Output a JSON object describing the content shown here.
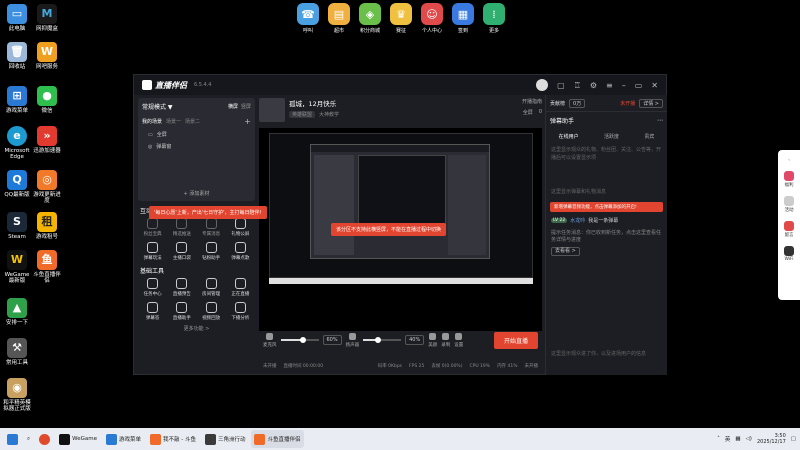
{
  "desktop": {
    "icons": [
      {
        "label": "此电脑",
        "icon": "computer-icon",
        "color": "#3d8fe0"
      },
      {
        "label": "网抑魔盒",
        "icon": "m-app-icon",
        "color": "#1a1a1a"
      },
      {
        "label": "回收站",
        "icon": "recycle-bin-icon",
        "color": "#9bb8d8"
      },
      {
        "label": "网吧服务",
        "icon": "w-service-icon",
        "color": "#f0a020"
      },
      {
        "label": "游戏菜单",
        "icon": "game-menu-icon",
        "color": "#2a7ad4"
      },
      {
        "label": "微信",
        "icon": "wechat-icon",
        "color": "#2fbf4f"
      },
      {
        "label": "Microsoft Edge",
        "icon": "edge-icon",
        "color": "#1d9bd1"
      },
      {
        "label": "迅游加速器",
        "icon": "accelerator-icon",
        "color": "#e33a2f"
      },
      {
        "label": "QQ最新版",
        "icon": "qq-icon",
        "color": "#1e7ad8"
      },
      {
        "label": "游戏更新进度",
        "icon": "update-progress-icon",
        "color": "#f07a2a"
      },
      {
        "label": "Steam",
        "icon": "steam-icon",
        "color": "#1b2838"
      },
      {
        "label": "游戏租号",
        "icon": "rent-account-icon",
        "color": "#f5b400"
      },
      {
        "label": "WeGame最新版",
        "icon": "wegame-icon",
        "color": "#111"
      },
      {
        "label": "斗鱼直播伴侣",
        "icon": "douyu-icon",
        "color": "#f06a2a"
      },
      {
        "label": "安排一下",
        "icon": "arrange-icon",
        "color": "#2fa04a"
      },
      {
        "label": "常用工具",
        "icon": "tools-icon",
        "color": "#555"
      },
      {
        "label": "和平精英模拟器正式版",
        "icon": "peace-elite-icon",
        "color": "#c8a060"
      }
    ],
    "launcher": [
      {
        "label": "呼叫",
        "icon": "call-icon",
        "color": "#4aa0e0"
      },
      {
        "label": "超市",
        "icon": "market-icon",
        "color": "#f0b040"
      },
      {
        "label": "积分商城",
        "icon": "points-mall-icon",
        "color": "#6abf4b"
      },
      {
        "label": "赛征",
        "icon": "contest-icon",
        "color": "#f0c040"
      },
      {
        "label": "个人中心",
        "icon": "profile-icon",
        "color": "#e04a4a"
      },
      {
        "label": "签到",
        "icon": "checkin-icon",
        "color": "#3a7ae0"
      },
      {
        "label": "更多",
        "icon": "more-apps-icon",
        "color": "#2fb070"
      }
    ]
  },
  "app": {
    "name": "直播伴侣",
    "version": "6.5.4.4",
    "left": {
      "mode": "常规模式 ▼",
      "mode_tabs": [
        "横屏",
        "竖屏"
      ],
      "scene_tabs": [
        "我的场景",
        "场景一",
        "场景二"
      ],
      "sources": [
        "全屏",
        "弹幕窗"
      ],
      "add_material": "+ 添加素材",
      "interactive_title": "互动",
      "interactive_tools": [
        "粉丝宝典",
        "精选推送",
        "专属消息",
        "礼物公屏",
        "弹幕玩法",
        "主播口袋",
        "钻粉助手",
        "弹幕点歌"
      ],
      "basic_title": "基础工具",
      "basic_tools": [
        "任务中心",
        "直播预告",
        "房间管理",
        "正在直播",
        "弹幕答",
        "直播助手",
        "视频回放",
        "下播分析"
      ],
      "more": "更多功能 >"
    },
    "center": {
      "title": "孤城，12月快乐",
      "sub_tags": [
        "英雄联盟",
        "大神教学"
      ],
      "head_actions": [
        "开播指南",
        "全屏",
        "0"
      ],
      "toasts": [
        "'每日心愿'上新，产出'七日守护'，主打每日陪伴!",
        "该分区不支持此横竖屏，不能在直播过程中切换"
      ],
      "mic_label": "麦克风",
      "mic_level": 60,
      "mic_pct": "60%",
      "speaker_label": "扬声器",
      "speaker_level": 40,
      "speaker_pct": "40%",
      "right_controls": [
        "美颜",
        "录制",
        "设置"
      ],
      "start_button": "开始直播",
      "status": [
        "未开播",
        "直播时间 00:00:00",
        "码率 0Kbps",
        "FPS 25",
        "丢帧 0(0.00%)",
        "CPU 19%",
        "内存 41%",
        "未开播"
      ]
    },
    "right": {
      "contribution": "贡献榜",
      "count": "0万",
      "live_status": "未开播",
      "detail": "详情 >",
      "bullet_title": "弹幕助手",
      "tabs": [
        "在线用户",
        "活跃度",
        "贵宾"
      ],
      "messages": [
        "这里显示观众的礼物、粉丝团、关注、公告等，开播后可以设置显示项",
        "这里显示弹幕和礼物消息"
      ],
      "toast": "新增弹幕音频功能，点击弹幕添加的开启!",
      "user_level": "LV 22",
      "user_nick": "水龙吟",
      "user_msg": "我是一条弹幕",
      "notice": "提示任务消息：你已收到新任务，点击这里查看任务详情与进度",
      "notice_link": "去看看 >",
      "bottom_tip": "这里显示观众进了你，以及进场用户的信息"
    }
  },
  "side_bar": [
    "福利",
    "活动",
    "留言",
    "WiFi"
  ],
  "taskbar": {
    "items": [
      {
        "label": "WeGame",
        "icon": "wegame-icon",
        "color": "#111",
        "active": false
      },
      {
        "label": "游戏菜单",
        "icon": "game-menu-icon",
        "color": "#2a7ad4",
        "active": false
      },
      {
        "label": "我不敲 - 斗鱼",
        "icon": "douyu-tab-icon",
        "color": "#f06a2a",
        "active": false
      },
      {
        "label": "三角洲行动",
        "icon": "delta-icon",
        "color": "#3a3a3a",
        "active": false
      },
      {
        "label": "斗鱼直播伴侣",
        "icon": "douyu-icon",
        "color": "#f06a2a",
        "active": true
      }
    ],
    "ime": "英",
    "time": "3:50",
    "date": "2025/12/17"
  },
  "colors": {
    "accent": "#e2452f",
    "panel": "#1d1e24",
    "desktop_bg": "#000000"
  }
}
